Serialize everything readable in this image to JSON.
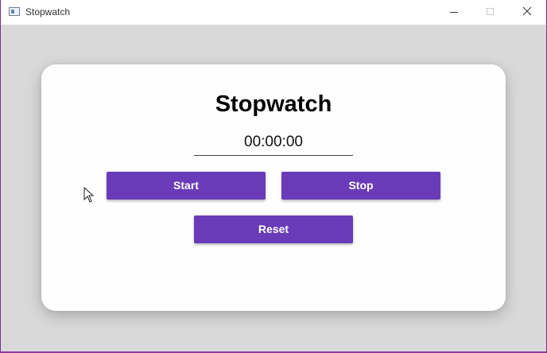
{
  "window": {
    "title": "Stopwatch",
    "icon": "app-window-icon"
  },
  "card": {
    "title": "Stopwatch",
    "time": "00:00:00",
    "buttons": {
      "start": "Start",
      "stop": "Stop",
      "reset": "Reset"
    }
  },
  "colors": {
    "accent": "#6a3bb8",
    "background": "#d9d9d9",
    "card": "#fefefe"
  }
}
